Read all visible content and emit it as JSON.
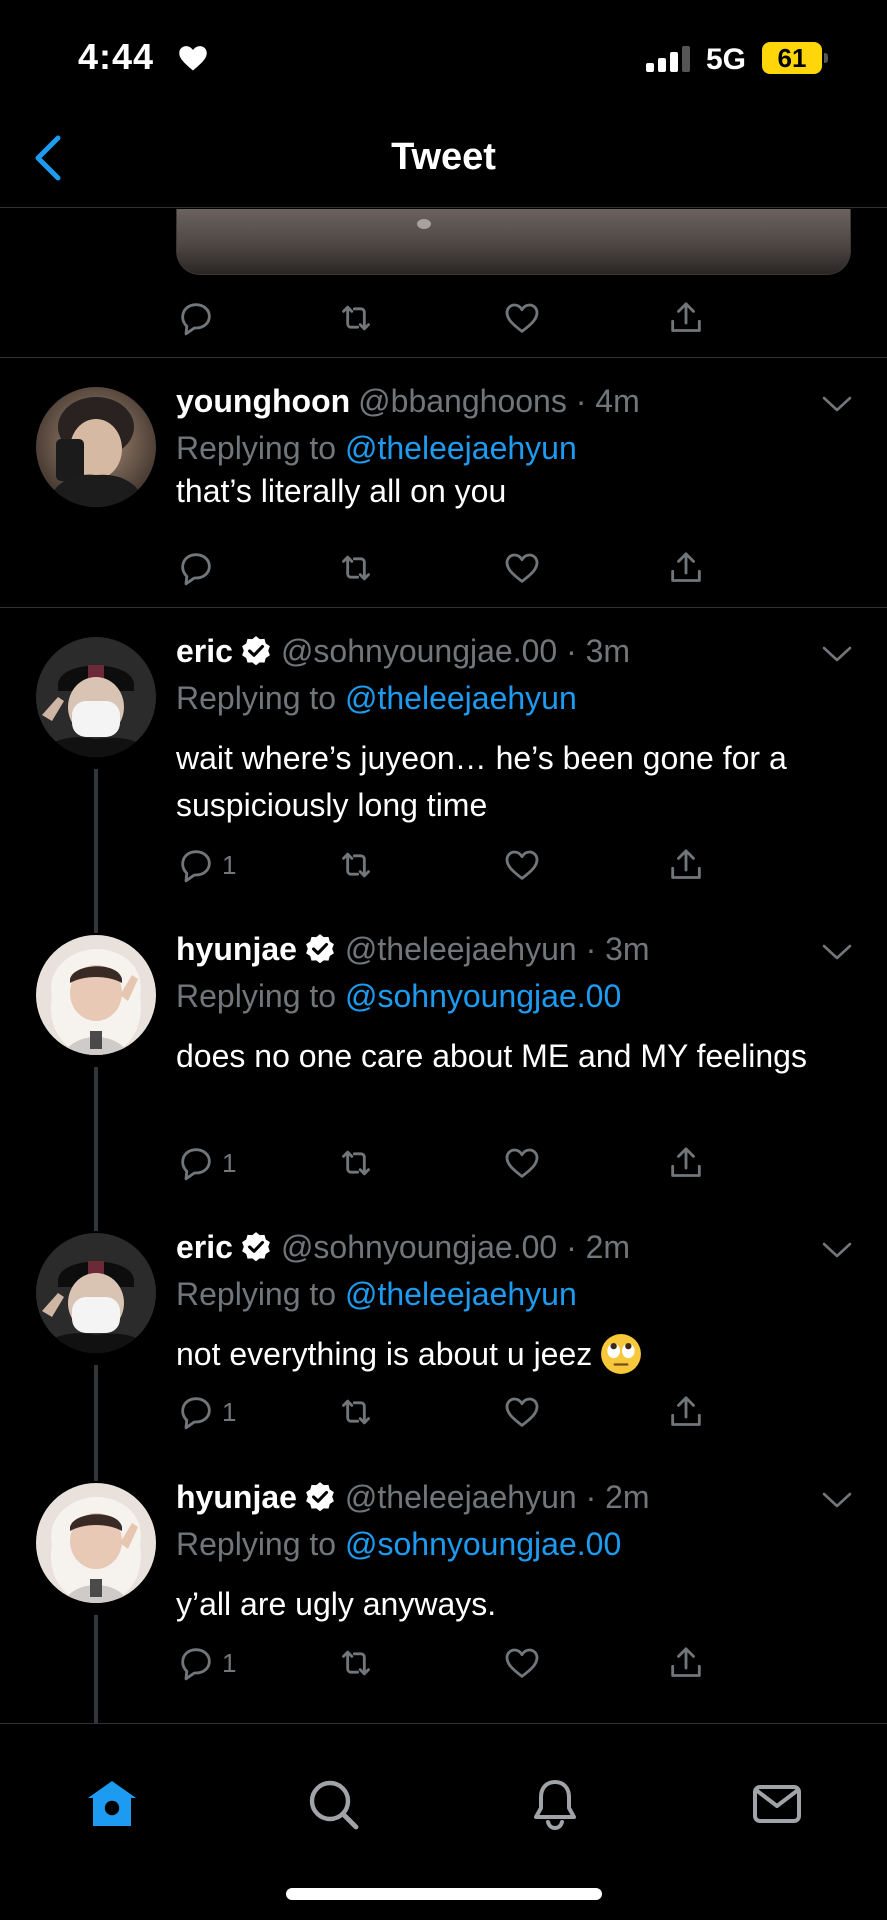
{
  "status_bar": {
    "time": "4:44",
    "network": "5G",
    "battery": "61"
  },
  "header": {
    "title": "Tweet"
  },
  "colors": {
    "accent": "#1d9bf0",
    "muted": "#71767b",
    "battery": "#ffd60a"
  },
  "tweets": [
    {
      "name": "younghoon",
      "verified": false,
      "handle": "@bbanghoons",
      "time": "4m",
      "replying_prefix": "Replying to ",
      "replying_to": "@theleejaehyun",
      "text": "that’s literally all on you",
      "reply_count": ""
    },
    {
      "name": "eric",
      "verified": true,
      "handle": "@sohnyoungjae.00",
      "time": "3m",
      "replying_prefix": "Replying to ",
      "replying_to": "@theleejaehyun",
      "text": "wait where’s juyeon… he’s been gone for a suspiciously long time",
      "reply_count": "1"
    },
    {
      "name": "hyunjae",
      "verified": true,
      "handle": "@theleejaehyun",
      "time": "3m",
      "replying_prefix": "Replying to ",
      "replying_to": "@sohnyoungjae.00",
      "text": "does no one care about ME and MY feelings",
      "reply_count": "1"
    },
    {
      "name": "eric",
      "verified": true,
      "handle": "@sohnyoungjae.00",
      "time": "2m",
      "replying_prefix": "Replying to ",
      "replying_to": "@theleejaehyun",
      "text": "not everything is about u jeez",
      "reply_count": "1"
    },
    {
      "name": "hyunjae",
      "verified": true,
      "handle": "@theleejaehyun",
      "time": "2m",
      "replying_prefix": "Replying to ",
      "replying_to": "@sohnyoungjae.00",
      "text": "y’all are ugly anyways.",
      "reply_count": "1"
    }
  ],
  "tabbar": {
    "items": [
      "home-icon",
      "search-icon",
      "notifications-icon",
      "messages-icon"
    ],
    "active": "home-icon"
  }
}
